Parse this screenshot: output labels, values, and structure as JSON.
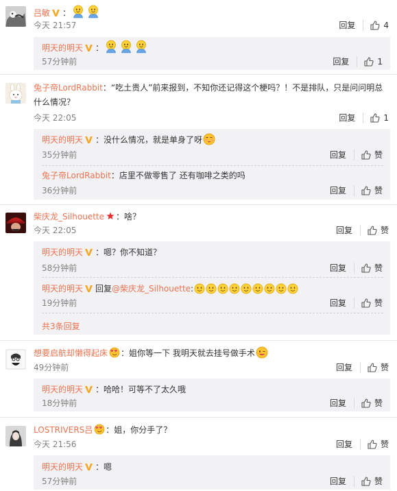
{
  "comments": [
    {
      "user": "吕敏",
      "sep": "：",
      "text": "",
      "time": "今天 21:57",
      "reply_label": "回复",
      "likes": "4",
      "replies": [
        {
          "user": "明天的明天",
          "sep": "：",
          "text": "",
          "time": "57分钟前",
          "reply_label": "回复",
          "likes": "1"
        }
      ]
    },
    {
      "user": "兔子帝LordRabbit",
      "sep": "：",
      "text": "“吃土贵人”前来报到，不知你还记得这个梗吗？！不是排队，只是问问明总什么情况？",
      "time": "今天 22:05",
      "reply_label": "回复",
      "likes": "1",
      "replies": [
        {
          "user": "明天的明天",
          "sep": "：",
          "text": "没什么情况，就是单身了呀",
          "time": "35分钟前",
          "reply_label": "回复",
          "likes": "赞"
        },
        {
          "user": "兔子帝LordRabbit",
          "sep": "：",
          "text": "店里不做零售了 还有咖啡之类的吗",
          "time": "36分钟前",
          "reply_label": "回复",
          "likes": "赞"
        }
      ]
    },
    {
      "user": "柴庆龙_Silhouette",
      "sep": "：",
      "text": "啥？",
      "time": "今天 22:05",
      "reply_label": "回复",
      "likes": "赞",
      "replies": [
        {
          "user": "明天的明天",
          "sep": "：",
          "text": "嗯？你不知道？",
          "time": "58分钟前",
          "reply_label": "回复",
          "likes": "赞"
        },
        {
          "user": "明天的明天",
          "sep": "：",
          "text_prefix": "回复",
          "at": "@柴庆龙_Silhouette",
          "text": ":",
          "time": "19分钟前",
          "reply_label": "回复",
          "likes": "赞"
        }
      ],
      "more": "共3条回复"
    },
    {
      "user": "想要启航却懒得起床",
      "sep": "：",
      "text": "姐你等一下 我明天就去挂号做手术",
      "time": "49分钟前",
      "reply_label": "回复",
      "likes": "赞",
      "replies": [
        {
          "user": "明天的明天",
          "sep": "：",
          "text": "哈哈！可等不了太久哦",
          "time": "18分钟前",
          "reply_label": "回复",
          "likes": "赞"
        }
      ]
    },
    {
      "user": "LOSTRIVERS吕",
      "sep": "：",
      "text": "姐，你分手了？",
      "time": "今天 21:56",
      "reply_label": "回复",
      "likes": "赞",
      "replies": [
        {
          "user": "明天的明天",
          "sep": "：",
          "text": "嗯",
          "time": "57分钟前",
          "reply_label": "回复",
          "likes": "赞"
        }
      ]
    }
  ],
  "colors": {
    "username": "#eb7350",
    "subbox_bg": "#f2f2f5",
    "time": "#808080",
    "vip": "#f5a623"
  },
  "icons": [
    "thumbs-up-icon",
    "vip-v-icon",
    "emoji-smile-icon",
    "emoji-grin-icon",
    "emoji-kiss-icon",
    "star-icon",
    "heart-face-icon"
  ]
}
